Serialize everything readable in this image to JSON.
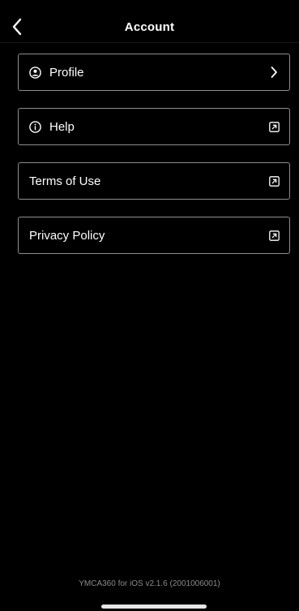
{
  "header": {
    "title": "Account",
    "back_icon": "chevron-left-icon"
  },
  "menu": {
    "items": [
      {
        "label": "Profile",
        "lead_icon": "user-circle-icon",
        "trail_icon": "chevron-right-icon"
      },
      {
        "label": "Help",
        "lead_icon": "info-circle-icon",
        "trail_icon": "external-link-icon"
      },
      {
        "label": "Terms of Use",
        "lead_icon": "",
        "trail_icon": "external-link-icon"
      },
      {
        "label": "Privacy Policy",
        "lead_icon": "",
        "trail_icon": "external-link-icon"
      }
    ]
  },
  "footer": {
    "version_text": "YMCA360 for iOS v2.1.6 (2001006001)"
  },
  "colors": {
    "background": "#000000",
    "text": "#ffffff",
    "border": "#8e8e8e",
    "footer_text": "#8a8a8a"
  }
}
